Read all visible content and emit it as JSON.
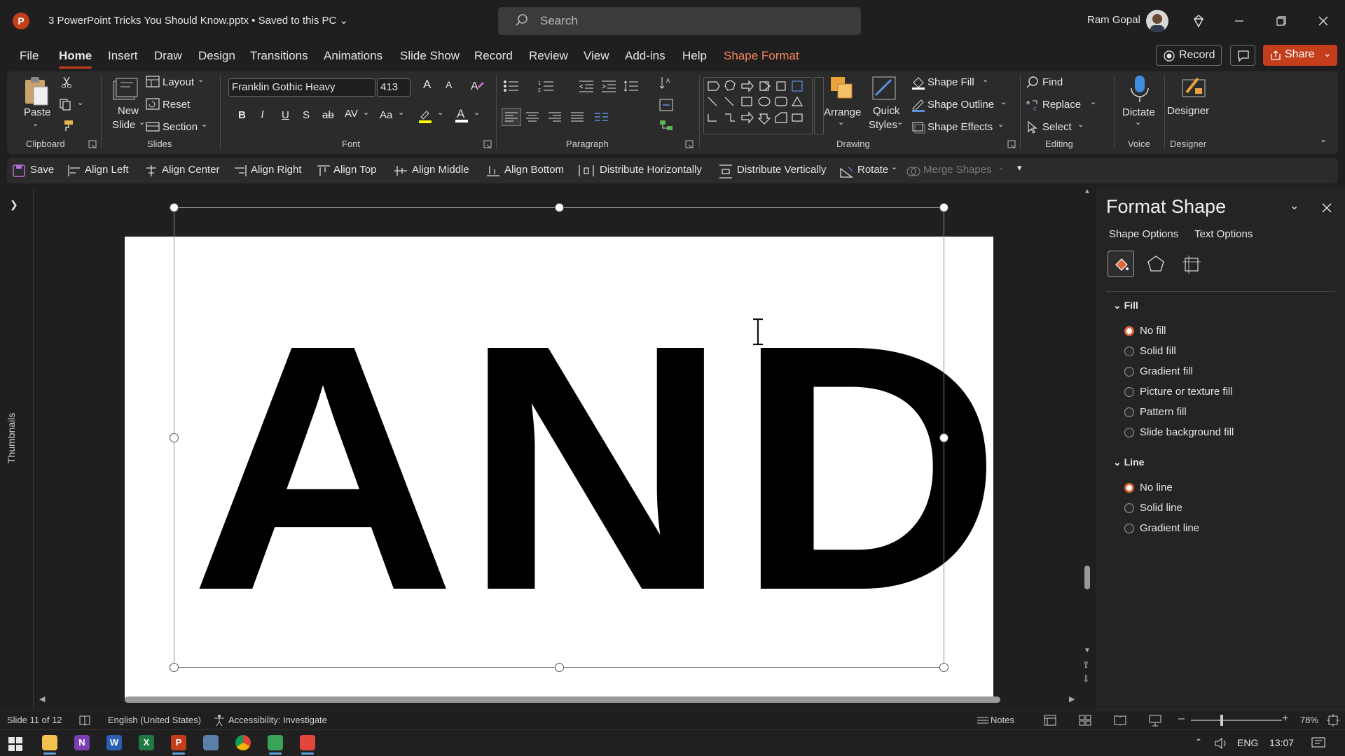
{
  "titlebar": {
    "document_title": "3 PowerPoint Tricks You Should Know.pptx • Saved to this PC",
    "search_placeholder": "Search",
    "user_name": "Ram Gopal",
    "app_logo": "P"
  },
  "menu": {
    "tabs": [
      "File",
      "Home",
      "Insert",
      "Draw",
      "Design",
      "Transitions",
      "Animations",
      "Slide Show",
      "Record",
      "Review",
      "View",
      "Add-ins",
      "Help",
      "Shape Format"
    ],
    "active_tab": "Home",
    "record_label": "Record",
    "share_label": "Share"
  },
  "ribbon": {
    "clipboard": {
      "paste": "Paste",
      "group": "Clipboard"
    },
    "slides": {
      "new_slide_1": "New",
      "new_slide_2": "Slide",
      "layout": "Layout",
      "reset": "Reset",
      "section": "Section",
      "group": "Slides"
    },
    "font": {
      "family": "Franklin Gothic Heavy",
      "size": "413",
      "group": "Font",
      "bold": "B",
      "italic": "I",
      "underline": "U",
      "shadow": "S",
      "strike": "ab",
      "spacing": "AV",
      "case": "Aa",
      "grow": "A",
      "shrink": "A"
    },
    "paragraph": {
      "group": "Paragraph"
    },
    "drawing": {
      "arrange": "Arrange",
      "quick_styles_1": "Quick",
      "quick_styles_2": "Styles",
      "shape_fill": "Shape Fill",
      "shape_outline": "Shape Outline",
      "shape_effects": "Shape Effects",
      "group": "Drawing"
    },
    "editing": {
      "find": "Find",
      "replace": "Replace",
      "select": "Select",
      "group": "Editing"
    },
    "voice": {
      "dictate": "Dictate",
      "group": "Voice"
    },
    "designer": {
      "designer": "Designer",
      "group": "Designer"
    }
  },
  "qat": {
    "items": [
      "Save",
      "Align Left",
      "Align Center",
      "Align Right",
      "Align Top",
      "Align Middle",
      "Align Bottom",
      "Distribute Horizontally",
      "Distribute Vertically",
      "Rotate",
      "Merge Shapes"
    ]
  },
  "workspace": {
    "thumbnails_label": "Thumbnails",
    "slide_text": "AND"
  },
  "pane": {
    "title": "Format Shape",
    "tabs": [
      "Shape Options",
      "Text Options"
    ],
    "fill_heading": "Fill",
    "fill_options": [
      "No fill",
      "Solid fill",
      "Gradient fill",
      "Picture or texture fill",
      "Pattern fill",
      "Slide background fill"
    ],
    "line_heading": "Line",
    "line_options": [
      "No line",
      "Solid line",
      "Gradient line"
    ]
  },
  "status": {
    "slide_counter": "Slide 11 of 12",
    "language": "English (United States)",
    "accessibility": "Accessibility: Investigate",
    "notes": "Notes",
    "zoom": "78%"
  },
  "taskbar": {
    "language": "ENG",
    "time": "13:07"
  },
  "colors": {
    "accent": "#c43e1c",
    "contextual_tab": "#f4845f",
    "radio_checked": "#e0683c"
  }
}
